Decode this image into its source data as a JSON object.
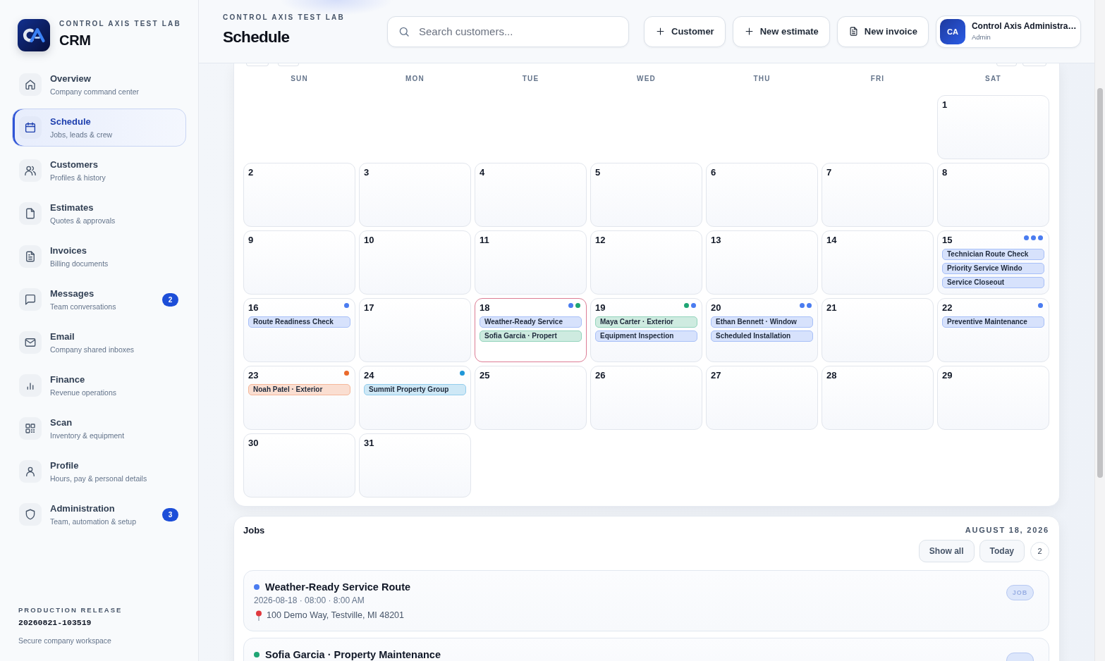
{
  "sidebar": {
    "org": "CONTROL AXIS TEST LAB",
    "app": "CRM",
    "items": [
      {
        "title": "Overview",
        "subtitle": "Company command center",
        "selected": false
      },
      {
        "title": "Schedule",
        "subtitle": "Jobs, leads & crew",
        "selected": true
      },
      {
        "title": "Customers",
        "subtitle": "Profiles & history",
        "selected": false
      },
      {
        "title": "Estimates",
        "subtitle": "Quotes & approvals",
        "selected": false
      },
      {
        "title": "Invoices",
        "subtitle": "Billing documents",
        "selected": false
      },
      {
        "title": "Messages",
        "subtitle": "Team conversations",
        "selected": false,
        "badge": "2"
      },
      {
        "title": "Email",
        "subtitle": "Company shared inboxes",
        "selected": false
      },
      {
        "title": "Finance",
        "subtitle": "Revenue operations",
        "selected": false
      },
      {
        "title": "Scan",
        "subtitle": "Inventory & equipment",
        "selected": false
      },
      {
        "title": "Profile",
        "subtitle": "Hours, pay & personal details",
        "selected": false
      },
      {
        "title": "Administration",
        "subtitle": "Team, automation & setup",
        "selected": false,
        "badge": "3"
      }
    ],
    "release_label": "PRODUCTION RELEASE",
    "release": "20260821-103519",
    "note": "Secure company workspace"
  },
  "header": {
    "org": "CONTROL AXIS TEST LAB",
    "title": "Schedule",
    "search": {
      "placeholder": "Search customers..."
    },
    "buttons": [
      {
        "label": "Customer"
      },
      {
        "label": "New estimate"
      },
      {
        "label": "New invoice"
      }
    ],
    "user": {
      "initials": "CA",
      "name": "Control Axis Administra…",
      "role": "Admin"
    }
  },
  "calendar": {
    "weekdays": [
      "SUN",
      "MON",
      "TUE",
      "WED",
      "THU",
      "FRI",
      "SAT"
    ],
    "weeks": [
      [
        {
          "date": "1",
          "selected": false
        }
      ],
      [
        {
          "date": "2",
          "selected": false
        },
        {
          "date": "3",
          "selected": false
        },
        {
          "date": "4",
          "selected": false
        },
        {
          "date": "5",
          "selected": false
        },
        {
          "date": "6",
          "selected": false
        },
        {
          "date": "7",
          "selected": false
        },
        {
          "date": "8",
          "selected": false
        }
      ],
      [
        {
          "date": "9",
          "selected": false
        },
        {
          "date": "10",
          "selected": false
        },
        {
          "date": "11",
          "selected": false
        },
        {
          "date": "12",
          "selected": false
        },
        {
          "date": "13",
          "selected": false
        },
        {
          "date": "14",
          "selected": false
        },
        {
          "date": "15",
          "selected": false,
          "events": [
            {
              "title": "Technician Route Check",
              "color": "#4a7cf0"
            },
            {
              "title": "Priority Service Windo",
              "color": "#4a7cf0"
            },
            {
              "title": "Service Closeout",
              "color": "#4a7cf0"
            }
          ]
        }
      ],
      [
        {
          "date": "16",
          "selected": false,
          "events": [
            {
              "title": "Route Readiness Check",
              "color": "#4a7cf0"
            }
          ]
        },
        {
          "date": "17",
          "selected": false
        },
        {
          "date": "18",
          "selected": true,
          "events": [
            {
              "title": "Weather-Ready Service",
              "color": "#4a7cf0"
            },
            {
              "title": "Sofia Garcia · Propert",
              "color": "#1fa574"
            }
          ]
        },
        {
          "date": "19",
          "selected": false,
          "events": [
            {
              "title": "Maya Carter · Exterior",
              "color": "#1fa574"
            },
            {
              "title": "Equipment Inspection",
              "color": "#4a7cf0"
            }
          ]
        },
        {
          "date": "20",
          "selected": false,
          "events": [
            {
              "title": "Ethan Bennett · Window",
              "color": "#4a7cf0"
            },
            {
              "title": "Scheduled Installation",
              "color": "#4a7cf0"
            }
          ]
        },
        {
          "date": "21",
          "selected": false
        },
        {
          "date": "22",
          "selected": false,
          "events": [
            {
              "title": "Preventive Maintenance",
              "color": "#4a7cf0"
            }
          ]
        }
      ],
      [
        {
          "date": "23",
          "selected": false,
          "events": [
            {
              "title": "Noah Patel · Exterior",
              "color": "#ea6a2c"
            }
          ]
        },
        {
          "date": "24",
          "selected": false,
          "events": [
            {
              "title": "Summit Property Group",
              "color": "#1f97d8"
            }
          ]
        },
        {
          "date": "25",
          "selected": false
        },
        {
          "date": "26",
          "selected": false
        },
        {
          "date": "27",
          "selected": false
        },
        {
          "date": "28",
          "selected": false
        },
        {
          "date": "29",
          "selected": false
        }
      ],
      [
        {
          "date": "30",
          "selected": false
        },
        {
          "date": "31",
          "selected": false
        }
      ]
    ]
  },
  "jobs": {
    "title": "Jobs",
    "date": "AUGUST 18, 2026",
    "filters": [
      {
        "label": "Show all",
        "selected": false
      },
      {
        "label": "Today",
        "selected": false
      }
    ],
    "count": "2",
    "items": [
      {
        "title": "Weather-Ready Service Route",
        "color": "#4a7cf0",
        "time": "2026-08-18 · 08:00 · 8:00 AM",
        "address": "100 Demo Way, Testville, MI 48201",
        "badge": "JOB"
      },
      {
        "title": "Sofia Garcia · Property Maintenance",
        "color": "#1fa574"
      }
    ]
  }
}
